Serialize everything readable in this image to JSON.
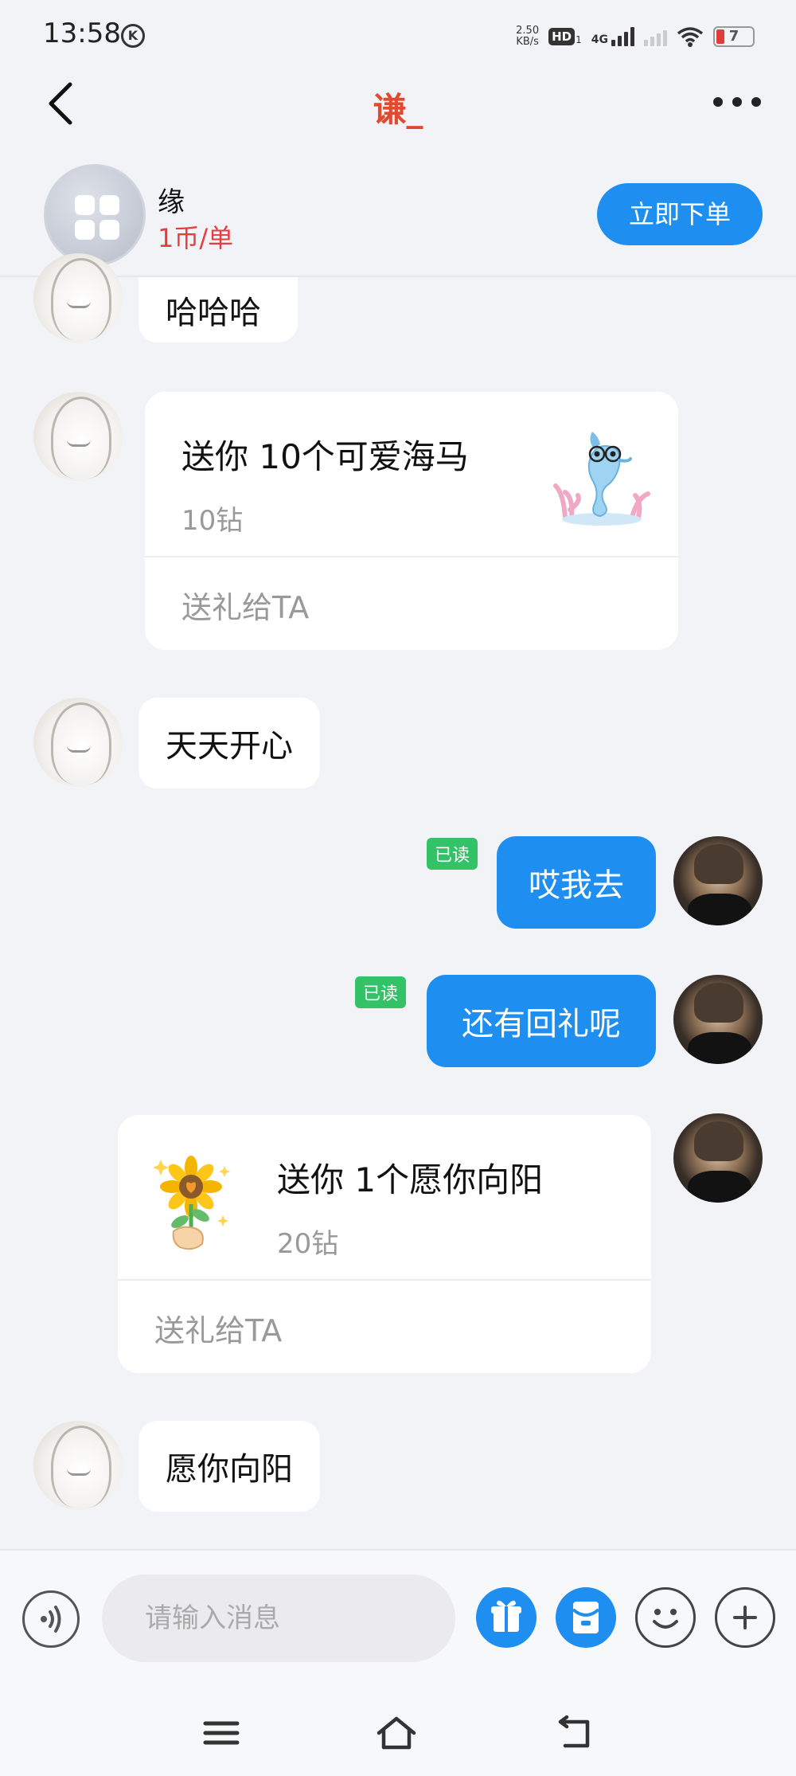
{
  "status": {
    "time": "13:58",
    "k_badge": "K",
    "speed_value": "2.50",
    "speed_unit": "KB/s",
    "hd": "HD",
    "hd_sub": "1",
    "network": "4G",
    "battery": "7"
  },
  "header": {
    "title": "谦_",
    "back_icon": "chevron-left-icon",
    "more_icon": "more-horizontal-icon"
  },
  "service": {
    "name": "缘",
    "price": "1币/单",
    "order_button": "立即下单"
  },
  "messages": [
    {
      "from": "other",
      "type": "text",
      "text": "哈哈哈"
    },
    {
      "from": "other",
      "type": "gift",
      "title": "送你 10个可爱海马",
      "price": "10钻",
      "action": "送礼给TA",
      "icon": "seahorse-icon"
    },
    {
      "from": "other",
      "type": "text",
      "text": "天天开心"
    },
    {
      "from": "me",
      "type": "text",
      "text": "哎我去",
      "status": "已读"
    },
    {
      "from": "me",
      "type": "text",
      "text": "还有回礼呢",
      "status": "已读"
    },
    {
      "from": "me",
      "type": "gift",
      "title": "送你 1个愿你向阳",
      "price": "20钻",
      "action": "送礼给TA",
      "icon": "sunflower-icon"
    },
    {
      "from": "other",
      "type": "text",
      "text": "愿你向阳"
    }
  ],
  "input": {
    "placeholder": "请输入消息",
    "voice_icon": "voice-icon",
    "gift_icon": "gift-icon",
    "redpacket_icon": "red-packet-icon",
    "emoji_icon": "emoji-icon",
    "plus_icon": "plus-icon"
  },
  "colors": {
    "accent": "#1e8ff0",
    "title": "#e4492e",
    "price": "#e53e3e",
    "read_badge": "#34c269",
    "background": "#f2f3f7"
  }
}
